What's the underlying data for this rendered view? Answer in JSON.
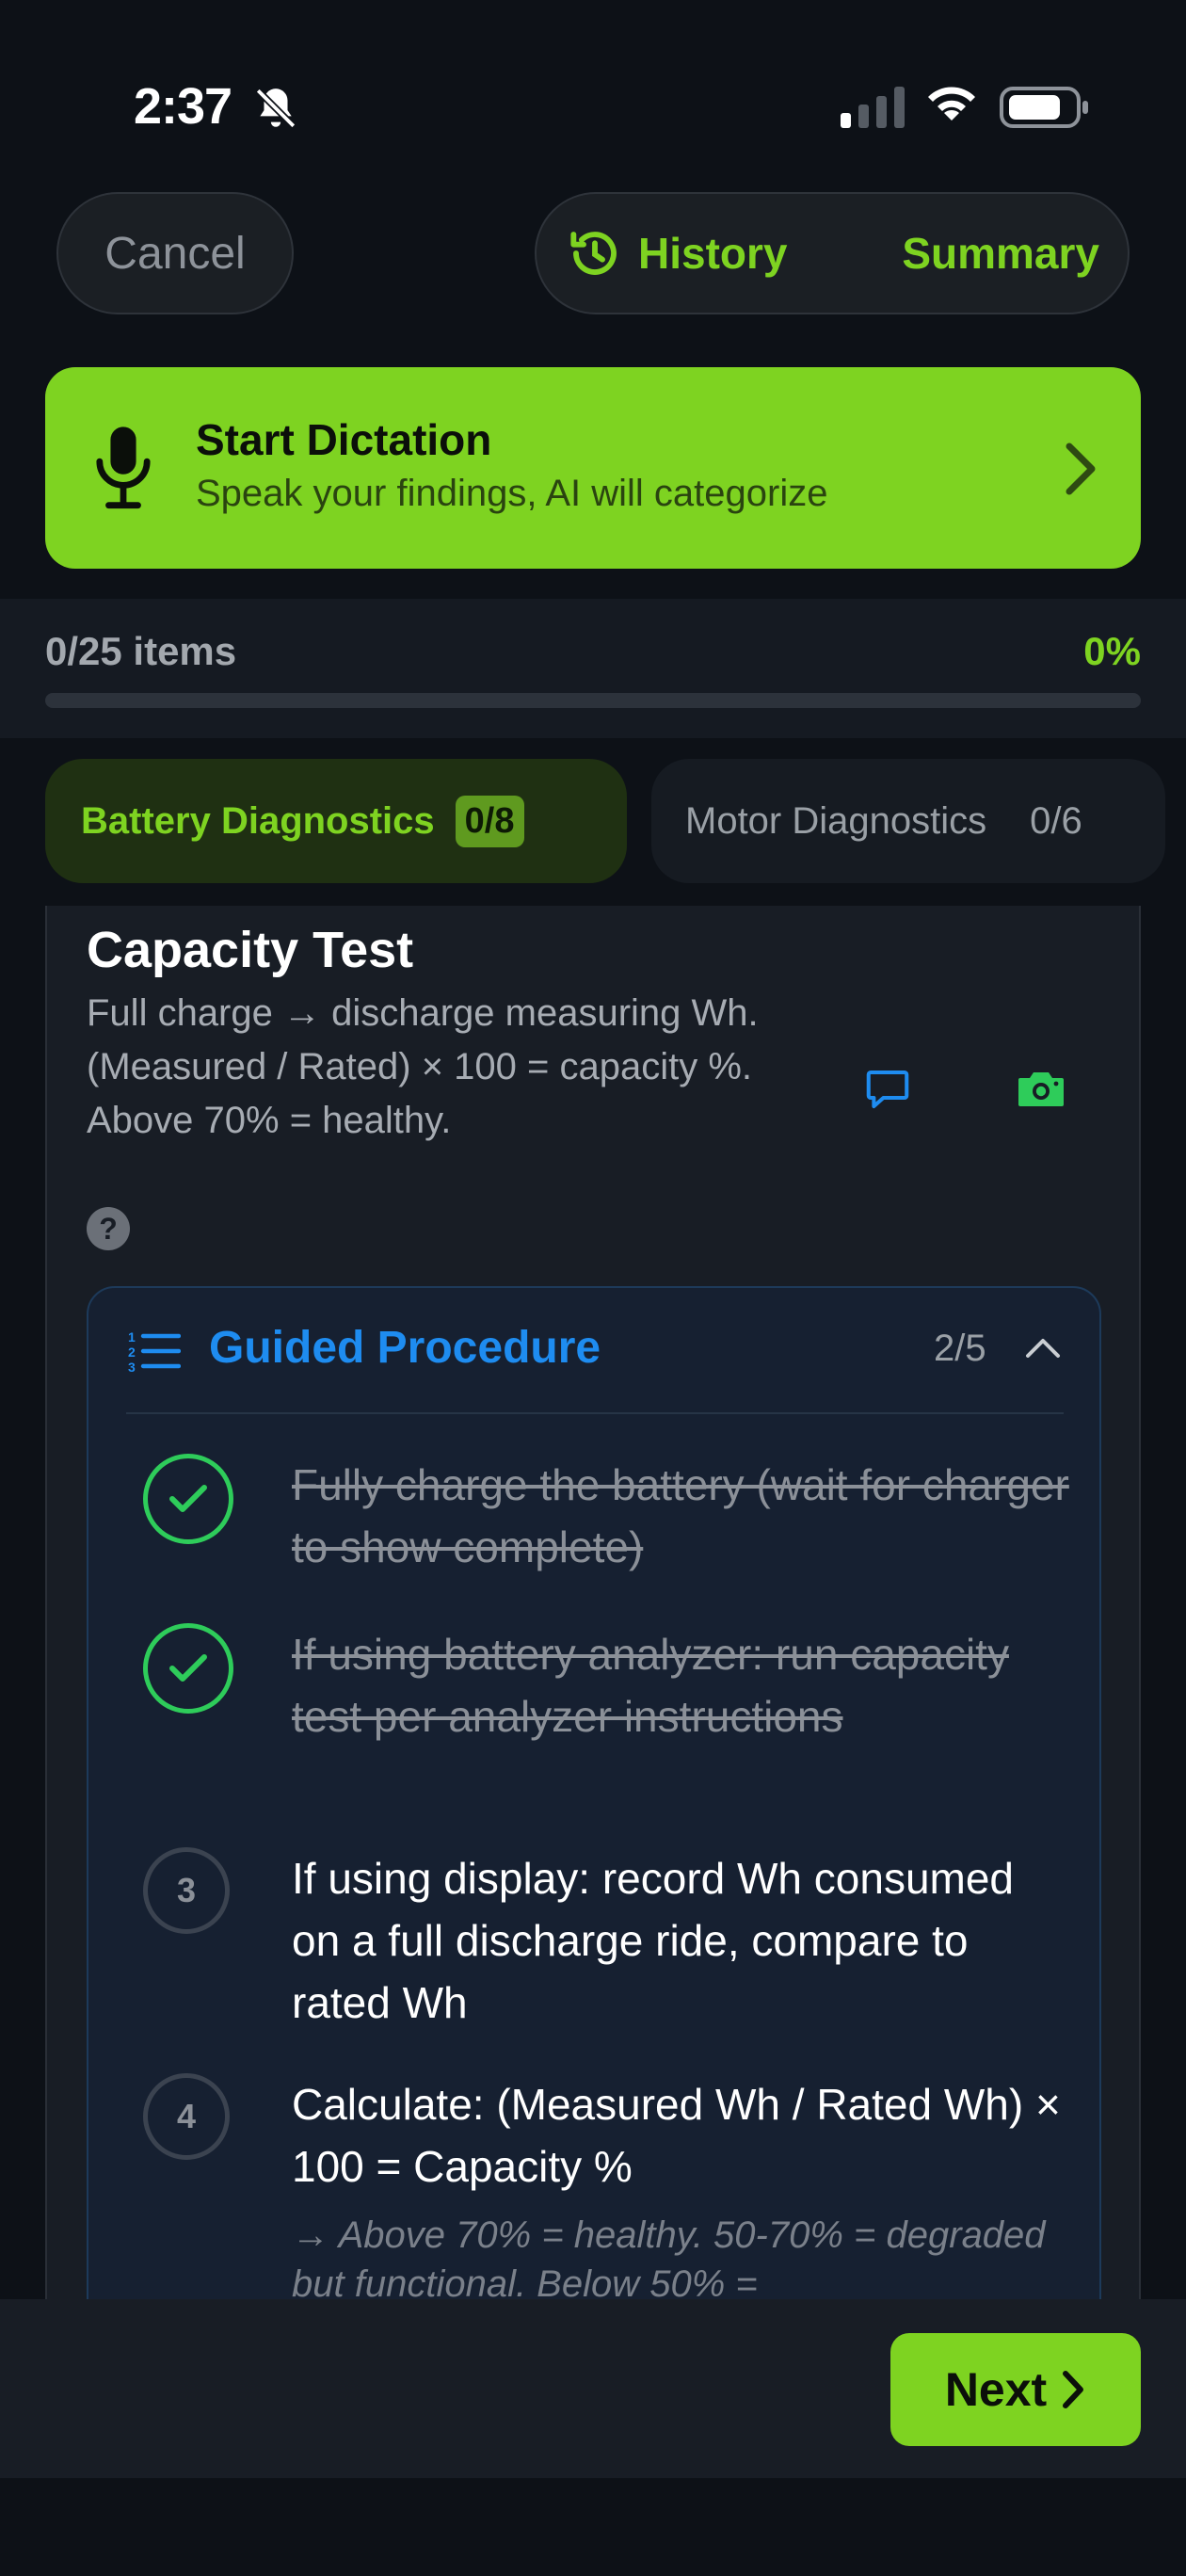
{
  "status_bar": {
    "time": "2:37",
    "icons": [
      "bell-slash-icon",
      "signal-icon",
      "wifi-icon",
      "battery-icon"
    ]
  },
  "header": {
    "cancel_label": "Cancel",
    "history_label": "History",
    "summary_label": "Summary"
  },
  "dictation": {
    "title": "Start Dictation",
    "subtitle": "Speak your findings, AI will categorize"
  },
  "progress": {
    "count_label": "0/25 items",
    "percent_label": "0%",
    "fraction": 0
  },
  "tabs": [
    {
      "label": "Battery Diagnostics",
      "count": "0/8",
      "active": true
    },
    {
      "label": "Motor Diagnostics",
      "count": "0/6",
      "active": false
    }
  ],
  "card": {
    "title": "Capacity Test",
    "description": "Full charge → discharge measuring Wh. (Measured / Rated) × 100 = capacity %. Above 70% = healthy.",
    "help_glyph": "?"
  },
  "procedure": {
    "title": "Guided Procedure",
    "count": "2/5",
    "steps": [
      {
        "number": "1",
        "text": "Fully charge the battery (wait for charger to show complete)",
        "done": true
      },
      {
        "number": "2",
        "text": "If using battery analyzer: run capacity test per analyzer instructions",
        "done": true
      },
      {
        "number": "3",
        "text": "If using display: record Wh consumed on a full discharge ride, compare to rated Wh",
        "done": false
      },
      {
        "number": "4",
        "text": "Calculate: (Measured Wh / Rated Wh) × 100 = Capacity %",
        "done": false,
        "note": "→ Above 70% = healthy. 50-70% = degraded but functional. Below 50% ="
      }
    ]
  },
  "footer": {
    "next_label": "Next"
  },
  "colors": {
    "accent_green": "#7ed321",
    "accent_blue": "#1e8cf0",
    "check_green": "#2ecc5a",
    "background": "#0d1117"
  }
}
